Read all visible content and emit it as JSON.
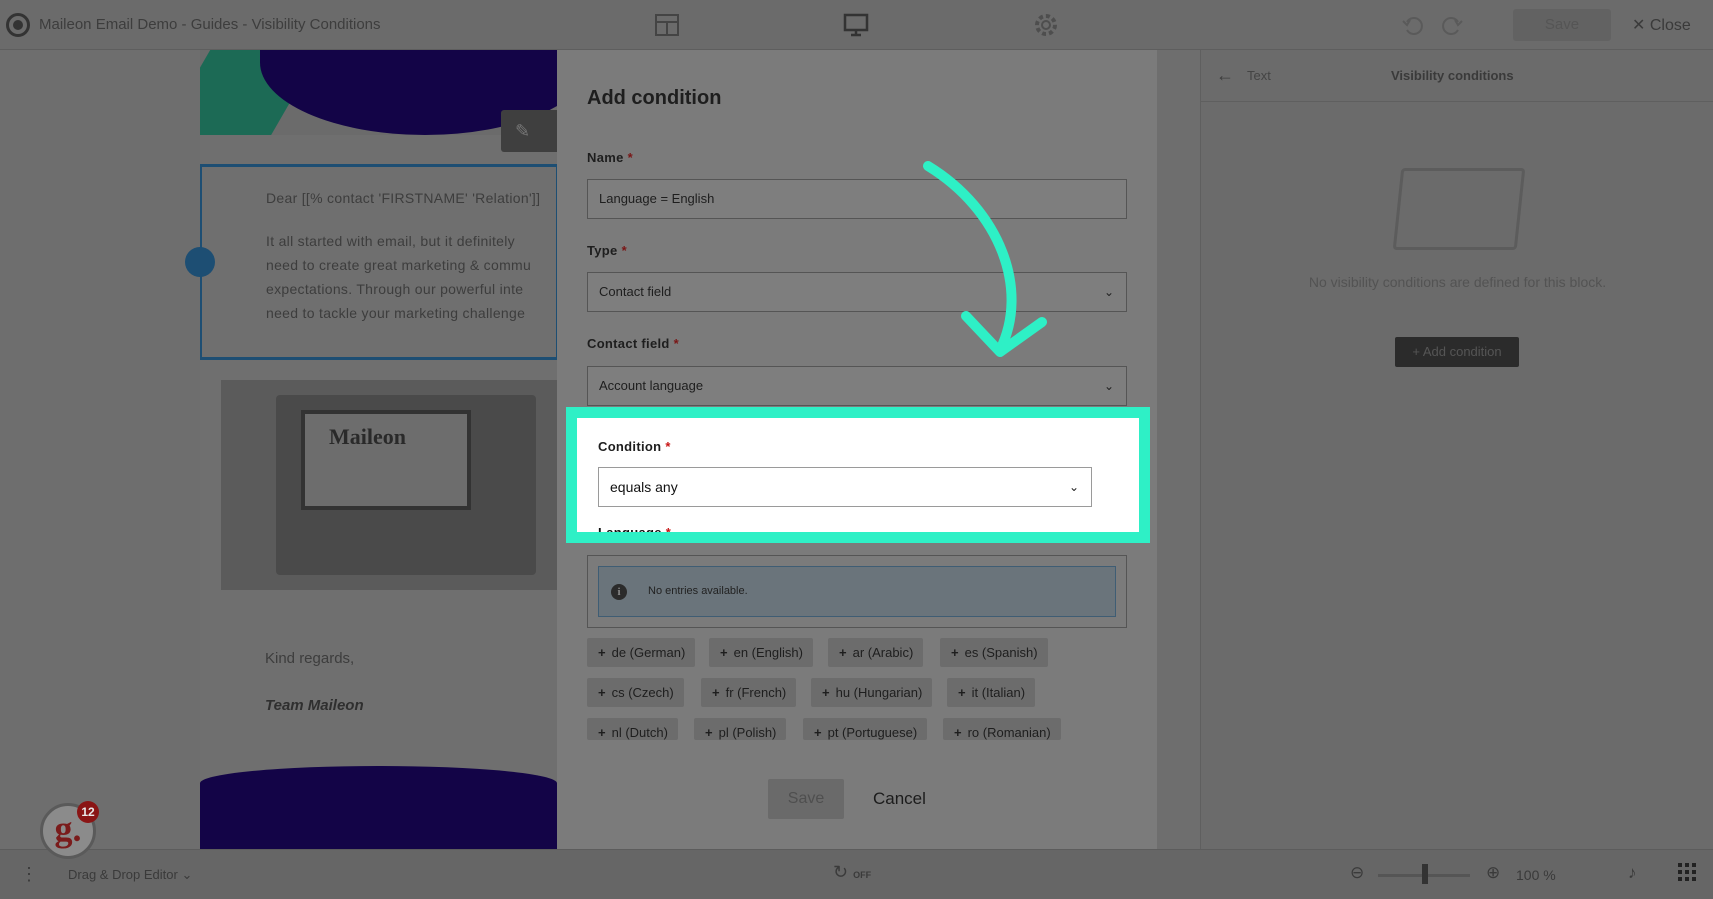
{
  "topbar": {
    "title": "Maileon Email Demo - Guides - Visibility Conditions",
    "save": "Save",
    "close": "Close",
    "close_icon": "✕"
  },
  "email": {
    "greeting": "Dear [[% contact 'FIRSTNAME' 'Relation']]",
    "body_lines": [
      "It all started with email, but it definitely",
      "need to create great marketing & commu",
      "expectations. Through our powerful inte",
      "need to tackle your marketing challenge"
    ],
    "photo_brand": "Maileon",
    "closing": "Kind regards,",
    "signature": "Team Maileon"
  },
  "sidepanel": {
    "back_label": "Text",
    "title": "Visibility conditions",
    "empty_message": "No visibility conditions are defined for this block.",
    "add_button": "+ Add condition"
  },
  "bottombar": {
    "editor_label": "Drag & Drop Editor",
    "history_state": "OFF",
    "zoom": "100 %"
  },
  "badge": {
    "letter": "g.",
    "count": "12"
  },
  "modal": {
    "title": "Add condition",
    "name": {
      "label": "Name",
      "required": "*",
      "value": "Language = English"
    },
    "type": {
      "label": "Type",
      "required": "*",
      "value": "Contact field"
    },
    "contact_field": {
      "label": "Contact field",
      "required": "*",
      "value": "Account language"
    },
    "condition": {
      "label": "Condition",
      "required": "*",
      "value": "equals any"
    },
    "language": {
      "label": "Language",
      "required": "*",
      "empty": "No entries available.",
      "options": [
        "de (German)",
        "en (English)",
        "ar (Arabic)",
        "es (Spanish)",
        "cs (Czech)",
        "fr (French)",
        "hu (Hungarian)",
        "it (Italian)",
        "nl (Dutch)",
        "pl (Polish)",
        "pt (Portuguese)",
        "ro (Romanian)"
      ]
    },
    "save": "Save",
    "cancel": "Cancel"
  },
  "colors": {
    "highlight": "#2ef0c6",
    "required": "#c81414",
    "brand_navy": "#130447"
  }
}
